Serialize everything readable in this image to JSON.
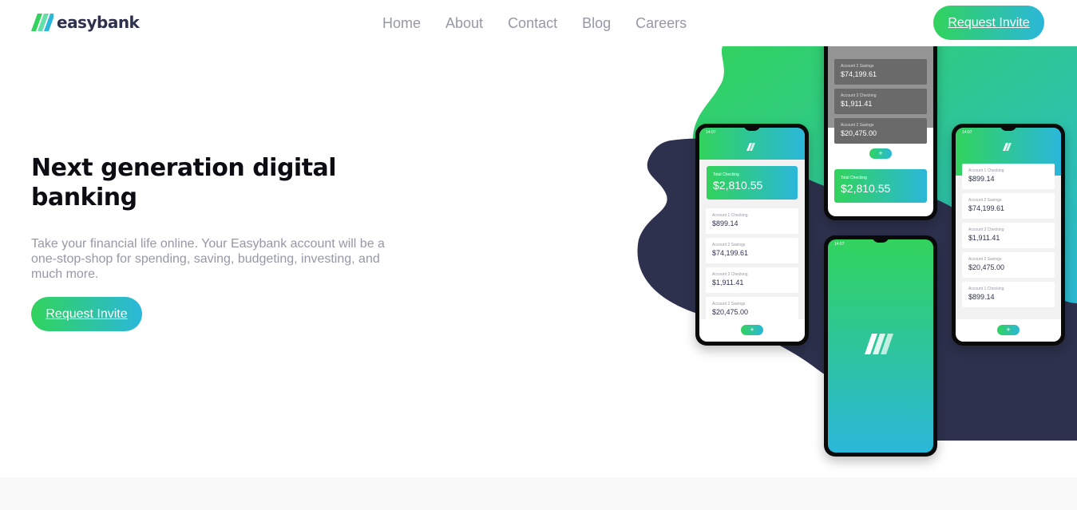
{
  "brand": {
    "name": "easybank"
  },
  "nav": {
    "items": [
      "Home",
      "About",
      "Contact",
      "Blog",
      "Careers"
    ]
  },
  "header": {
    "cta_label": "Request Invite"
  },
  "hero": {
    "title": "Next generation digital banking",
    "text": "Take your financial life online. Your Easybank account will be a one-stop-shop for spending, saving, budgeting, investing, and much more.",
    "cta_label": "Request Invite"
  },
  "phones": {
    "status_time": "14:07",
    "total_label": "Total Checking",
    "total_amount": "$2,810.55",
    "accounts": [
      {
        "label": "Account 1 Checking",
        "amount": "$899.14"
      },
      {
        "label": "Account 2 Savings",
        "amount": "$74,199.61"
      },
      {
        "label": "Account 3 Checking",
        "amount": "$1,911.41"
      },
      {
        "label": "Account 2 Savings",
        "amount": "$20,475.00"
      },
      {
        "label": "Account 1 Checking",
        "amount": "$899.14"
      }
    ],
    "fab_icon": "+"
  },
  "colors": {
    "accent_green": "#31d35c",
    "accent_cyan": "#2bb7da",
    "dark_navy": "#2d314d",
    "grayish_blue": "#9698a6"
  }
}
